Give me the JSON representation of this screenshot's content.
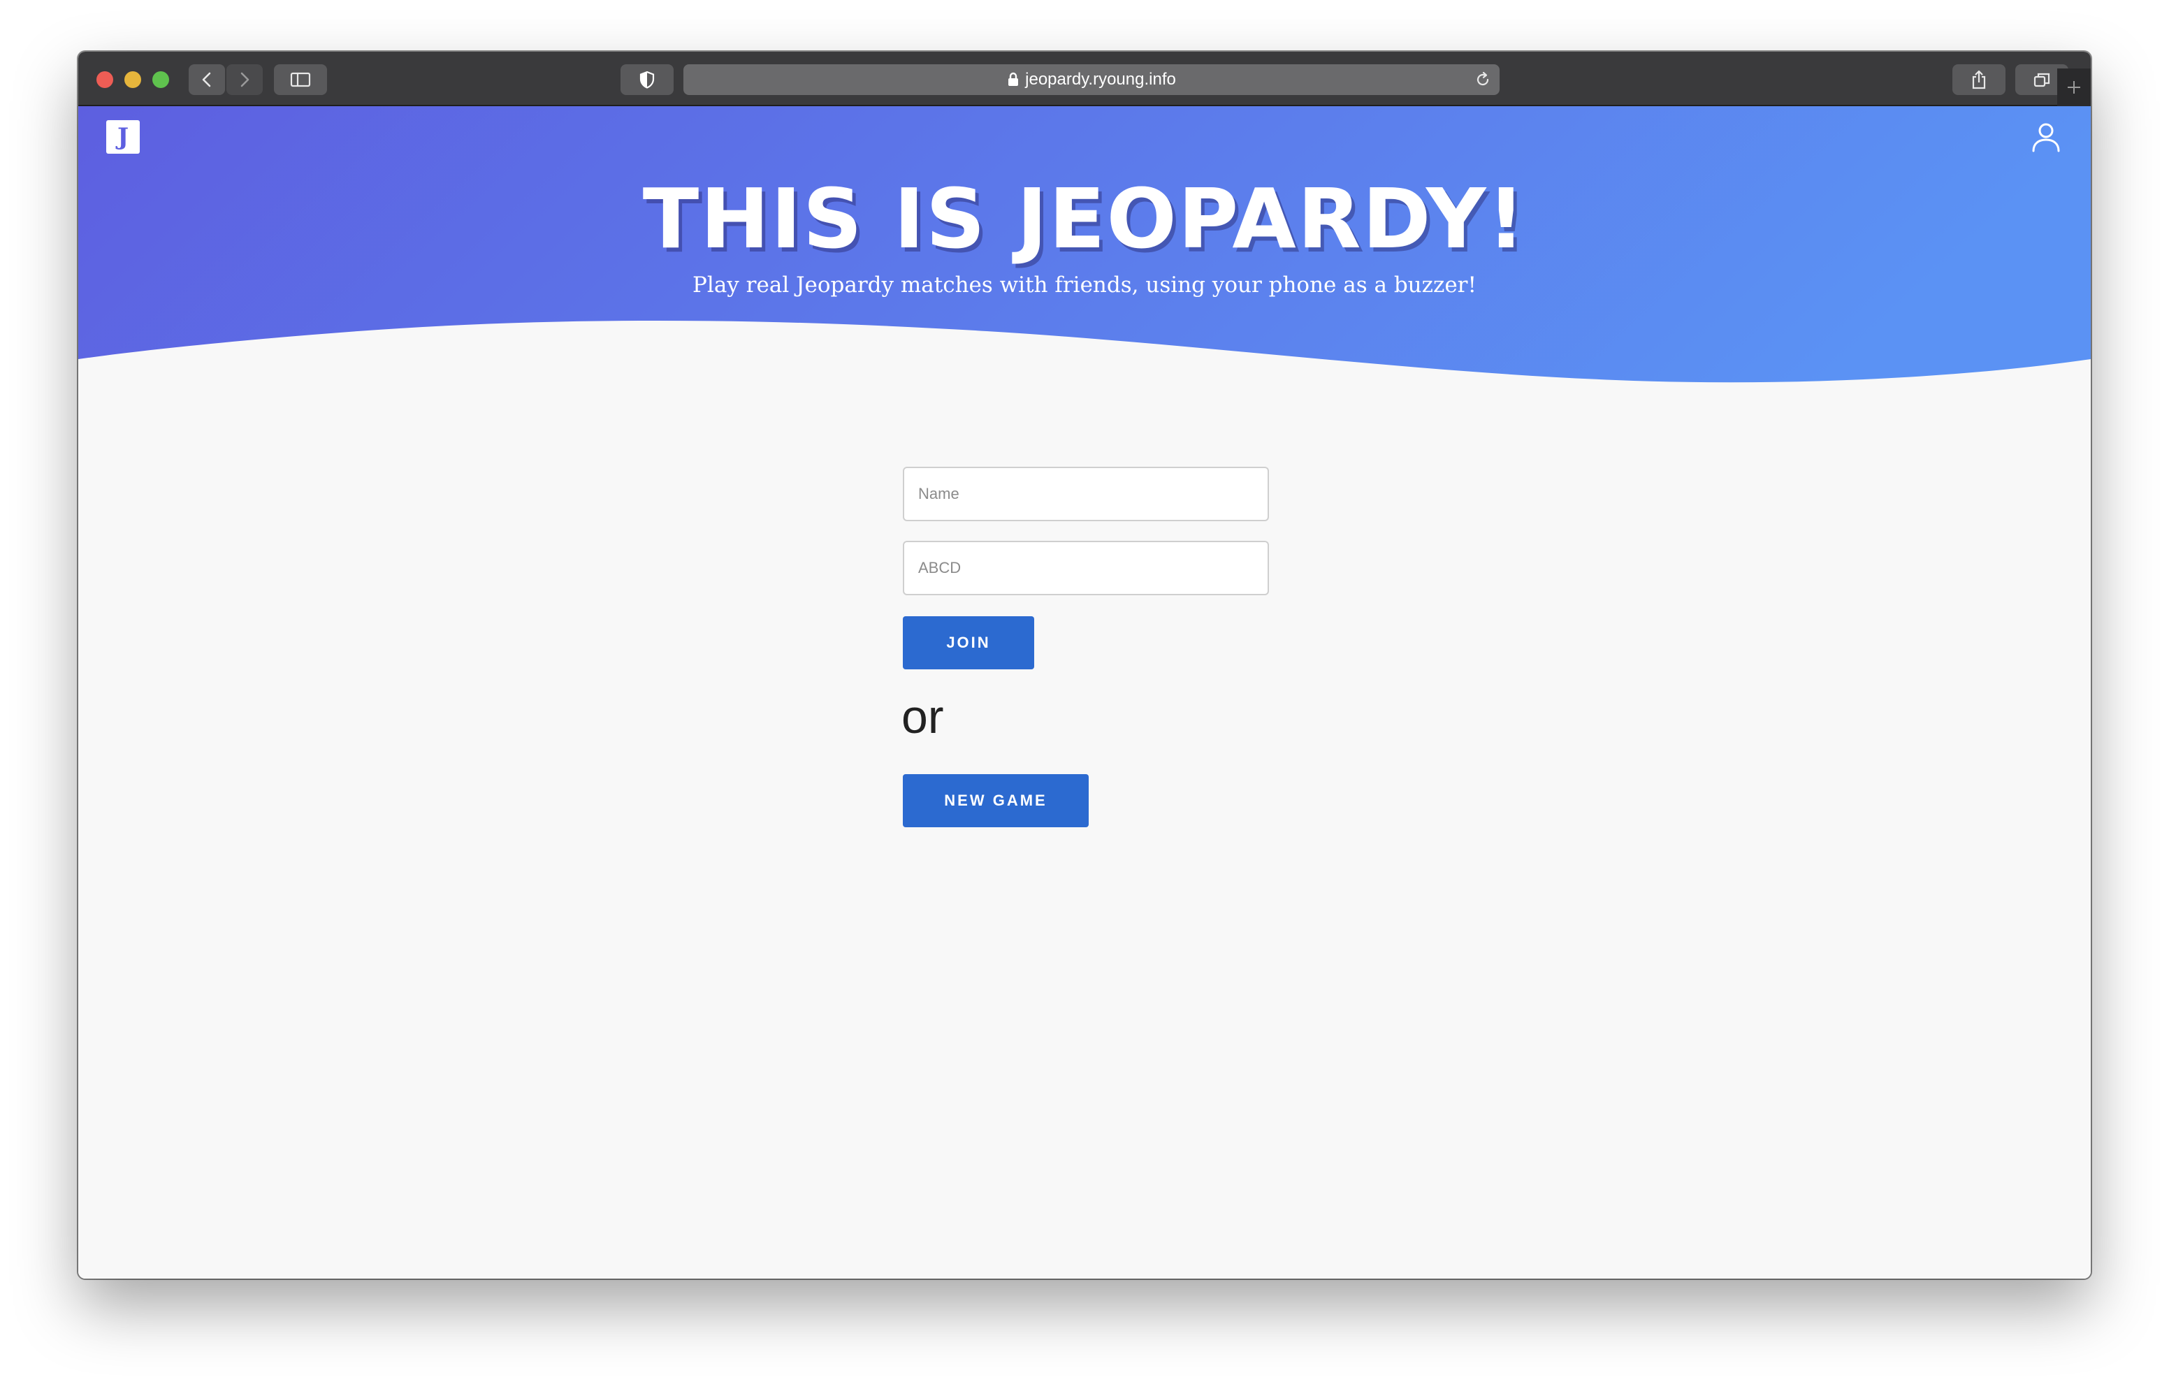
{
  "browser": {
    "url": "jeopardy.ryoung.info",
    "icons": {
      "close": "red-close-dot",
      "minimize": "yellow-minimize-dot",
      "zoom": "green-zoom-dot",
      "back": "chevron-left-icon",
      "forward": "chevron-right-icon",
      "sidebar": "sidebar-icon",
      "privacy": "shield-icon",
      "lock": "lock-icon",
      "reload": "reload-icon",
      "share": "share-icon",
      "tabs": "tabs-overview-icon",
      "new_tab": "plus-icon"
    }
  },
  "header": {
    "logo_letter": "J",
    "user_icon": "user-icon"
  },
  "hero": {
    "title": "THIS IS JEOPARDY!",
    "subtitle": "Play real Jeopardy matches with friends, using your phone as a buzzer!",
    "gradient_start": "#5d5fe0",
    "gradient_end": "#5b92f4"
  },
  "form": {
    "name_placeholder": "Name",
    "name_value": "",
    "code_placeholder": "ABCD",
    "code_value": "",
    "join_label": "JOIN",
    "or_text": "or",
    "new_game_label": "NEW GAME",
    "button_color": "#2c6ad0"
  }
}
